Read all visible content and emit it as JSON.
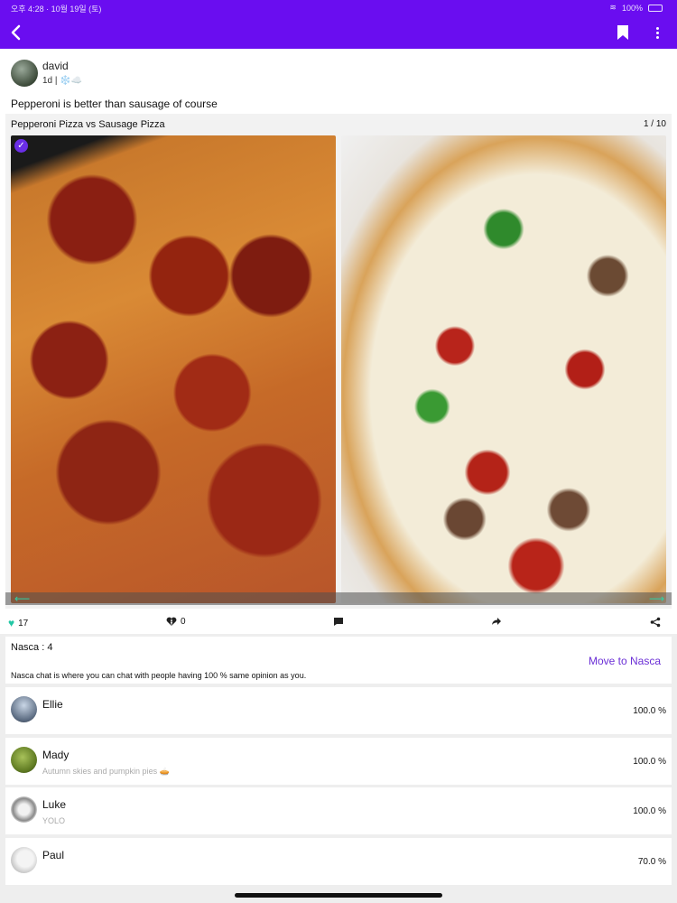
{
  "status_bar": {
    "time_date": "오후 4:28 · 10월 19일 (토)",
    "battery": "100%"
  },
  "header": {
    "back_icon": "chevron-left-icon",
    "bookmark_icon": "bookmark-icon",
    "more_icon": "more-vertical-icon"
  },
  "post": {
    "author": "david",
    "meta": "1d | ❄️☁️",
    "text": "Pepperoni is better than sausage of course"
  },
  "poll": {
    "title": "Pepperoni Pizza vs Sausage Pizza",
    "page": "1 / 10",
    "selected_option": "Pepperoni Pizza"
  },
  "actions": {
    "likes": "17",
    "dislikes": "0"
  },
  "nasca": {
    "title": "Nasca : 4",
    "move_label": "Move to Nasca",
    "description": "Nasca chat is where you can chat with people having 100 % same opinion as you."
  },
  "members": [
    {
      "name": "Ellie",
      "status": "",
      "percent": "100.0 %"
    },
    {
      "name": "Mady",
      "status": "Autumn skies and pumpkin pies 🥧",
      "percent": "100.0 %"
    },
    {
      "name": "Luke",
      "status": "YOLO",
      "percent": "100.0 %"
    },
    {
      "name": "Paul",
      "status": "",
      "percent": "70.0 %"
    }
  ],
  "colors": {
    "accent": "#6a0df0",
    "link": "#6b2fd6",
    "like": "#22c7a5"
  }
}
